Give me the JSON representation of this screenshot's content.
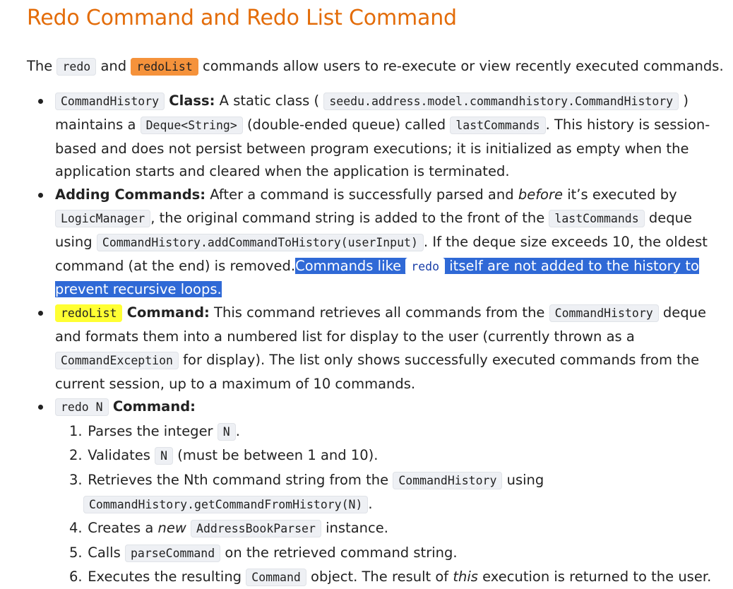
{
  "title": "Redo Command and Redo List Command",
  "intro": {
    "t1": "The",
    "code1": "redo",
    "t2": "and",
    "code2": "redoList",
    "t3": "commands allow users to re-execute or view recently executed commands."
  },
  "bullets": {
    "history": {
      "code1": "CommandHistory",
      "label": "Class:",
      "t1": "A static class (",
      "code2": "seedu.address.model.commandhistory.CommandHistory",
      "t2": ") maintains a",
      "code3": "Deque<String>",
      "t3": "(double-ended queue) called",
      "code4": "lastCommands",
      "t4": ". This history is session-based and does not persist between program executions; it is initialized as empty when the application starts and cleared when the application is terminated."
    },
    "adding": {
      "label": "Adding Commands:",
      "t1": "After a command is successfully parsed and",
      "em1": "before",
      "t2": "it’s executed by",
      "code1": "LogicManager",
      "t3": ", the original command string is added to the front of the",
      "code2": "lastCommands",
      "t4": "deque using",
      "code3": "CommandHistory.addCommandToHistory(userInput)",
      "t5": ". If the deque size exceeds 10, the oldest command (at the end) is removed.",
      "sel1": "Commands like",
      "sel_code": "redo",
      "sel2": "itself are not added to the history to prevent recursive loops."
    },
    "redolist": {
      "code1": "redoList",
      "label": "Command:",
      "t1": "This command retrieves all commands from the",
      "code2": "CommandHistory",
      "t2": "deque and formats them into a numbered list for display to the user (currently thrown as a",
      "code3": "CommandException",
      "t3": "for display). The list only shows successfully executed commands from the current session, up to a maximum of 10 commands."
    },
    "redo": {
      "code1": "redo N",
      "label": "Command:",
      "steps": [
        {
          "num": "1.",
          "t1": "Parses the integer",
          "code1": "N",
          "t2": "."
        },
        {
          "num": "2.",
          "t1": "Validates",
          "code1": "N",
          "t2": "(must be between 1 and 10)."
        },
        {
          "num": "3.",
          "t1": "Retrieves the Nth command string from the",
          "code1": "CommandHistory",
          "t2": "using",
          "code2": "CommandHistory.getCommandFromHistory(N)",
          "t3": "."
        },
        {
          "num": "4.",
          "t1": "Creates a",
          "em1": "new",
          "code1": "AddressBookParser",
          "t2": "instance."
        },
        {
          "num": "5.",
          "t1": "Calls",
          "code1": "parseCommand",
          "t2": "on the retrieved command string."
        },
        {
          "num": "6.",
          "t1": "Executes the resulting",
          "code1": "Command",
          "t2": "object. The result of",
          "em1": "this",
          "t3": "execution is returned to the user."
        }
      ]
    }
  },
  "colors": {
    "title": "#e36c09",
    "code_bg": "#eef0f4",
    "highlight_orange": "#f5923b",
    "highlight_yellow": "#ffff33",
    "selection": "#2f69d6"
  }
}
